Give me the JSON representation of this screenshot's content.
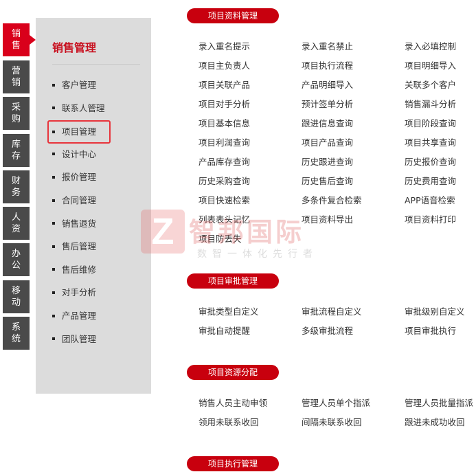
{
  "nav_tabs": [
    {
      "label": "销\n售",
      "active": true
    },
    {
      "label": "营\n销"
    },
    {
      "label": "采\n购"
    },
    {
      "label": "库\n存"
    },
    {
      "label": "财\n务"
    },
    {
      "label": "人\n资"
    },
    {
      "label": "办\n公"
    },
    {
      "label": "移\n动"
    },
    {
      "label": "系\n统"
    }
  ],
  "submenu": {
    "title": "销售管理",
    "items": [
      "客户管理",
      "联系人管理",
      "项目管理",
      "设计中心",
      "报价管理",
      "合同管理",
      "销售退货",
      "售后管理",
      "售后维修",
      "对手分析",
      "产品管理",
      "团队管理"
    ],
    "selected_index": 2
  },
  "sections": [
    {
      "title": "项目资料管理",
      "links": [
        "录入重名提示",
        "录入重名禁止",
        "录入必填控制",
        "项目主负责人",
        "项目执行流程",
        "项目明细导入",
        "项目关联产品",
        "产品明细导入",
        "关联多个客户",
        "项目对手分析",
        "预计签单分析",
        "销售漏斗分析",
        "项目基本信息",
        "跟进信息查询",
        "项目阶段查询",
        "项目利润查询",
        "项目产品查询",
        "项目共享查询",
        "产品库存查询",
        "历史跟进查询",
        "历史报价查询",
        "历史采购查询",
        "历史售后查询",
        "历史费用查询",
        "项目快速检索",
        "多条件复合检索",
        "APP语音检索",
        "列表表头记忆",
        "项目资料导出",
        "项目资料打印",
        "项目防丢失"
      ]
    },
    {
      "title": "项目审批管理",
      "links": [
        "审批类型自定义",
        "审批流程自定义",
        "审批级别自定义",
        "审批自动提醒",
        "多级审批流程",
        "项目审批执行"
      ]
    },
    {
      "title": "项目资源分配",
      "links": [
        "销售人员主动申领",
        "管理人员单个指派",
        "管理人员批量指派",
        "领用未联系收回",
        "间隔未联系收回",
        "跟进未成功收回"
      ]
    },
    {
      "title": "项目执行管理",
      "links": []
    }
  ],
  "watermark": {
    "logo_letter": "Z",
    "brand": "智邦国际",
    "slogan": "数智一体化先行者"
  },
  "colors": {
    "accent": "#d9001b",
    "tab_bg": "#4a4a4a",
    "panel_bg": "#dcdcdc"
  }
}
